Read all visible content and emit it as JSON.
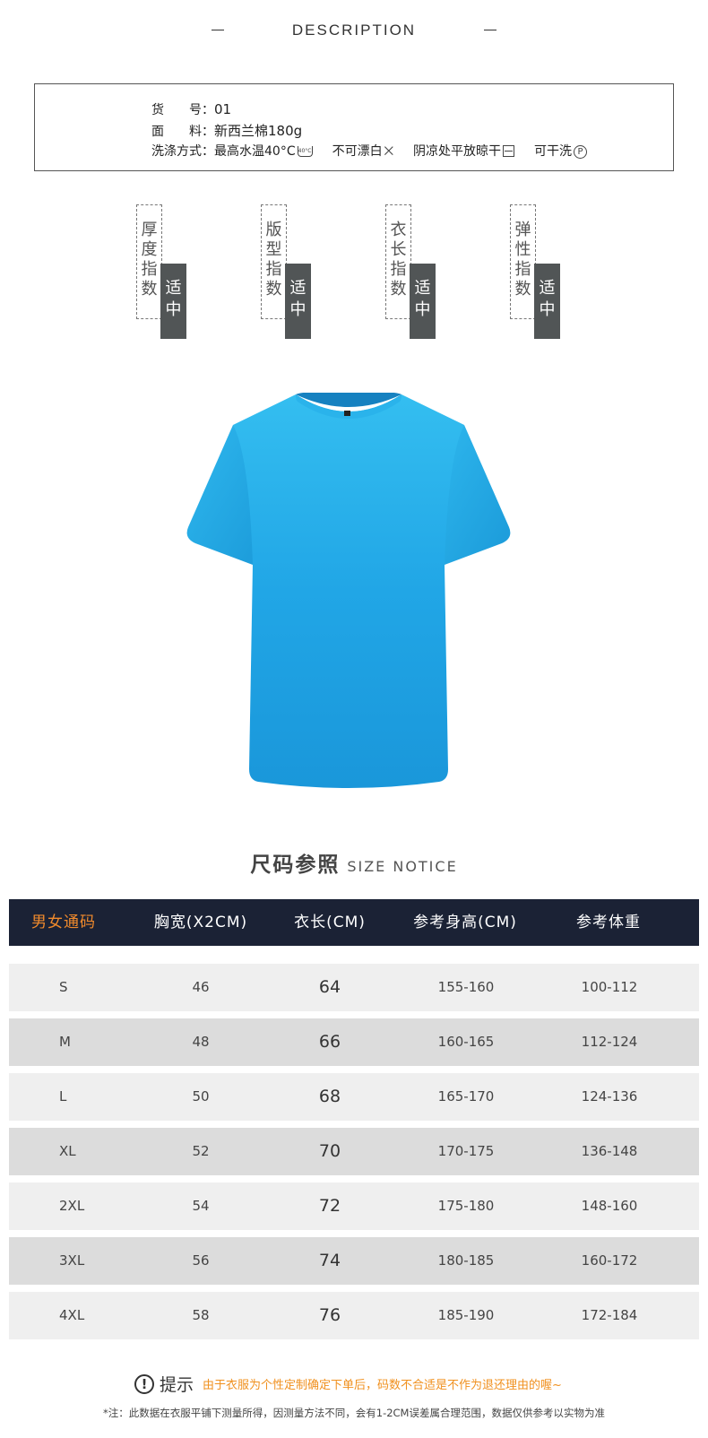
{
  "header": {
    "title": "DESCRIPTION"
  },
  "specs": {
    "item_no_label": "货　　号：",
    "item_no": "01",
    "material_label": "面　　料：",
    "material": "新西兰棉180g",
    "wash_label": "洗涤方式：",
    "wash": [
      {
        "text": "最高水温40°C",
        "icon": "wash-40-icon",
        "icon_text": "40°C"
      },
      {
        "text": "不可漂白",
        "icon": "no-bleach-icon",
        "icon_text": "⨉"
      },
      {
        "text": "阴凉处平放晾干",
        "icon": "dry-flat-shade-icon",
        "icon_text": ""
      },
      {
        "text": "可干洗",
        "icon": "dry-clean-icon",
        "icon_text": "P"
      }
    ]
  },
  "indices": [
    {
      "label": "厚度指数",
      "value": "适中"
    },
    {
      "label": "版型指数",
      "value": "适中"
    },
    {
      "label": "衣长指数",
      "value": "适中"
    },
    {
      "label": "弹性指数",
      "value": "适中"
    }
  ],
  "product": {
    "color": "#22a6e6",
    "image": "blue-tshirt"
  },
  "size_section": {
    "title_cn": "尺码参照",
    "title_en": "SIZE NOTICE"
  },
  "size_table": {
    "headers": [
      "男女通码",
      "胸宽(X2CM)",
      "衣长(CM)",
      "参考身高(CM)",
      "参考体重"
    ],
    "rows": [
      [
        "S",
        "46",
        "64",
        "155-160",
        "100-112"
      ],
      [
        "M",
        "48",
        "66",
        "160-165",
        "112-124"
      ],
      [
        "L",
        "50",
        "68",
        "165-170",
        "124-136"
      ],
      [
        "XL",
        "52",
        "70",
        "170-175",
        "136-148"
      ],
      [
        "2XL",
        "54",
        "72",
        "175-180",
        "148-160"
      ],
      [
        "3XL",
        "56",
        "74",
        "180-185",
        "160-172"
      ],
      [
        "4XL",
        "58",
        "76",
        "185-190",
        "172-184"
      ]
    ]
  },
  "notes": {
    "tip_label": "提示",
    "tip_text": "由于衣服为个性定制确定下单后，码数不合适是不作为退还理由的喔~",
    "footnote": "*注：此数据在衣服平铺下测量所得，因测量方法不同，会有1-2CM误差属合理范围，数据仅供参考以实物为准"
  },
  "colors": {
    "header_bg": "#1b2235",
    "accent": "#f08a2c",
    "row_light": "#efefef",
    "row_dark": "#dcdcdc",
    "index_bg": "#515556"
  }
}
